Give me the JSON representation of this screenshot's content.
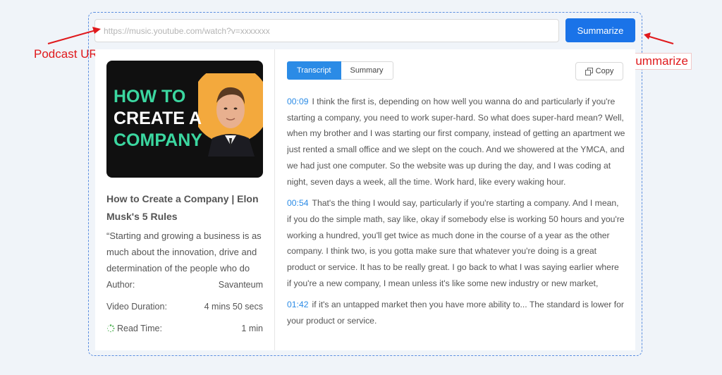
{
  "search": {
    "value": "",
    "placeholder": "https://music.youtube.com/watch?v=xxxxxxx",
    "button_label": "Summarize"
  },
  "annotations": {
    "url_note": "Podcast URL",
    "summarize_note": "Summarize",
    "color": "#e0191c"
  },
  "thumbnail": {
    "line1": "HOW TO",
    "line2": "CREATE A",
    "line3": "COMPANY"
  },
  "video": {
    "title": "How to Create a Company | Elon Musk's 5 Rules",
    "description": "“Starting and growing a business is as much about the innovation, drive and determination of the people who do it…"
  },
  "meta": {
    "author_label": "Author:",
    "author_value": "Savanteum",
    "duration_label": "Video Duration:",
    "duration_value": "4 mins 50 secs",
    "readtime_label": "Read Time:",
    "readtime_value": "1 min"
  },
  "tabs": {
    "transcript": "Transcript",
    "summary": "Summary",
    "active": "Transcript"
  },
  "copy_label": "Copy",
  "transcript": [
    {
      "time": "00:09",
      "text": "I think the first is, depending on how well you wanna do and particularly if you're starting a company, you need to work super-hard. So what does super-hard mean? Well, when my brother and I was starting our first company, instead of getting an apartment we just rented a small office and we slept on the couch. And we showered at the YMCA, and we had just one computer. So the website was up during the day, and I was coding at night, seven days a week, all the time. Work hard, like every waking hour."
    },
    {
      "time": "00:54",
      "text": "That's the thing I would say, particularly if you're starting a company. And I mean, if you do the simple math, say like, okay if somebody else is working 50 hours and you're working a hundred, you'll get twice as much done in the course of a year as the other company. I think two, is you gotta make sure that whatever you're doing is a great product or service. It has to be really great. I go back to what I was saying earlier where if you're a new company, I mean unless it's like some new industry or new market,"
    },
    {
      "time": "01:42",
      "text": "if it's an untapped market then you have more ability to... The standard is lower for your product or service."
    }
  ],
  "colors": {
    "accent": "#1a73e8",
    "tab_active": "#2b8be6",
    "timestamp": "#2b8be6"
  }
}
